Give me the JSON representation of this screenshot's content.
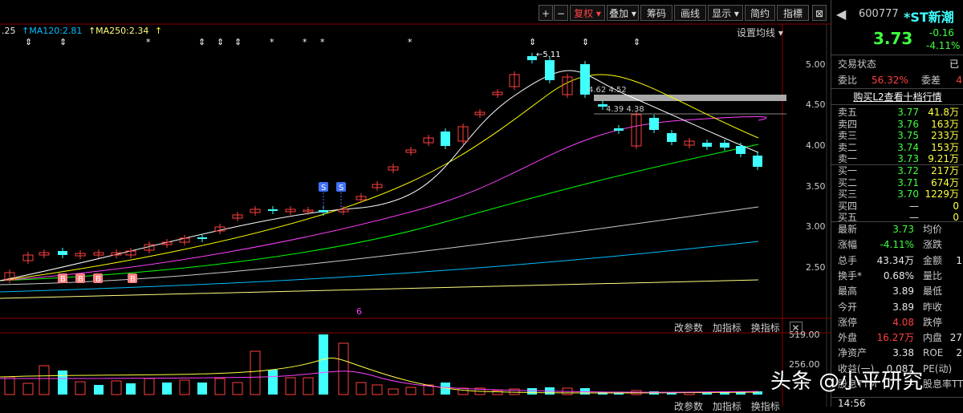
{
  "toolbar": {
    "buttons": [
      "+",
      "−",
      "复权",
      "叠加",
      "筹码",
      "画线",
      "显示",
      "简约",
      "指標",
      "⊠"
    ]
  },
  "ma_legend": {
    "prefix": ".25",
    "ma120": "MA120:2.81",
    "ma250": "MA250:2.34",
    "settings": "设置均线"
  },
  "price_axis": [
    "5.00",
    "4.50",
    "4.00",
    "3.50",
    "3.00",
    "2.50"
  ],
  "annotations": {
    "high": "5.11",
    "mid1": "4.62 4.52",
    "mid2": "4.39 4.38",
    "marker": "6",
    "s_label": "S",
    "b_label": "B",
    "star": "*",
    "arrow": "⇕"
  },
  "indicator_bar": {
    "labels": [
      "改参数",
      "加指标",
      "换指标"
    ],
    "vol_axis": [
      "519.00",
      "256.00"
    ]
  },
  "bottom_bar": {
    "labels": [
      "改参数",
      "加指标",
      "换指标"
    ]
  },
  "quote": {
    "code": "600777",
    "name": "*ST新潮",
    "price": "3.73",
    "change": "-0.16",
    "change_pct": "-4.11%",
    "trade_status": "交易状态",
    "weibi_label": "委比",
    "weibi_val": "56.32%",
    "weicha_label": "委差",
    "weicha_val": "4",
    "l2_link": "购买L2查看十档行情",
    "asks": [
      {
        "label": "卖五",
        "price": "3.77",
        "vol": "41.8万"
      },
      {
        "label": "卖四",
        "price": "3.76",
        "vol": "163万"
      },
      {
        "label": "卖三",
        "price": "3.75",
        "vol": "233万"
      },
      {
        "label": "卖二",
        "price": "3.74",
        "vol": "153万"
      },
      {
        "label": "卖一",
        "price": "3.73",
        "vol": "9.21万"
      }
    ],
    "bids": [
      {
        "label": "买一",
        "price": "3.72",
        "vol": "217万"
      },
      {
        "label": "买二",
        "price": "3.71",
        "vol": "674万"
      },
      {
        "label": "买三",
        "price": "3.70",
        "vol": "1229万"
      },
      {
        "label": "买四",
        "price": "—",
        "vol": "0"
      },
      {
        "label": "买五",
        "price": "—",
        "vol": "0"
      }
    ],
    "stats": [
      {
        "l1": "最新",
        "v1": "3.73",
        "c1": "grn",
        "l2": "均价",
        "v2": ""
      },
      {
        "l1": "涨幅",
        "v1": "-4.11%",
        "c1": "grn",
        "l2": "涨跌",
        "v2": ""
      },
      {
        "l1": "总手",
        "v1": "43.34万",
        "c1": "wht",
        "l2": "金额",
        "v2": "1"
      },
      {
        "l1": "换手*",
        "v1": "0.68%",
        "c1": "wht",
        "l2": "量比",
        "v2": ""
      },
      {
        "l1": "最高",
        "v1": "3.89",
        "c1": "wht",
        "l2": "最低",
        "v2": ""
      },
      {
        "l1": "今开",
        "v1": "3.89",
        "c1": "wht",
        "l2": "昨收",
        "v2": ""
      },
      {
        "l1": "涨停",
        "v1": "4.08",
        "c1": "red",
        "l2": "跌停",
        "v2": ""
      },
      {
        "l1": "外盘",
        "v1": "16.27万",
        "c1": "red",
        "l2": "内盘",
        "v2": "27"
      },
      {
        "l1": "净资产",
        "v1": "3.38",
        "c1": "wht",
        "l2": "ROE",
        "v2": "2"
      },
      {
        "l1": "收益(一)",
        "v1": "0.087",
        "c1": "wht",
        "l2": "PE(动)",
        "v2": ""
      },
      {
        "l1": "股息TTM",
        "v1": "—",
        "c1": "wht",
        "l2": "股息率TTM",
        "v2": ""
      }
    ],
    "time": "14:56"
  },
  "watermark": "头条 @小平研究",
  "colors": {
    "up": "#ff4040",
    "down": "#40ffff",
    "ma5": "#ffffff",
    "ma10": "#ffff00",
    "ma20": "#ff40ff",
    "ma30": "#00ff00",
    "ma60": "#cccccc",
    "ma120": "#00bfff",
    "ma250": "#ffff80"
  }
}
